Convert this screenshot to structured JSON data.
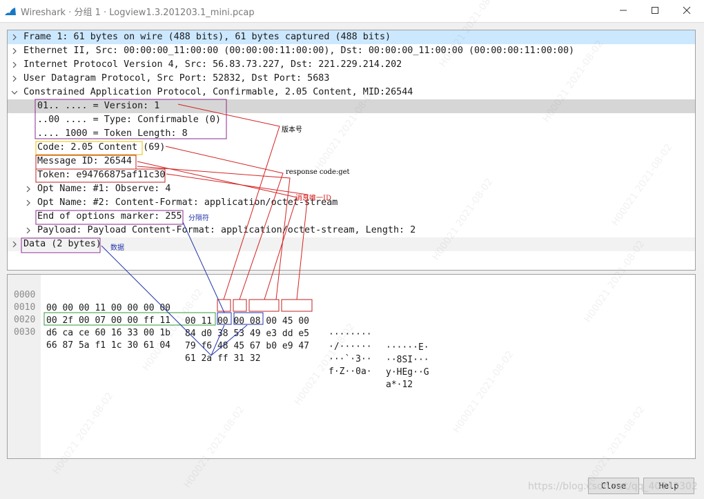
{
  "window": {
    "title": "Wireshark · 分组 1 · Logview1.3.201203.1_mini.pcap",
    "controls": [
      "minimize-icon",
      "maximize-icon",
      "close-icon"
    ]
  },
  "tree": [
    "Frame 1: 61 bytes on wire (488 bits), 61 bytes captured (488 bits)",
    "Ethernet II, Src: 00:00:00_11:00:00 (00:00:00:11:00:00), Dst: 00:00:00_11:00:00 (00:00:00:11:00:00)",
    "Internet Protocol Version 4, Src: 56.83.73.227, Dst: 221.229.214.202",
    "User Datagram Protocol, Src Port: 52832, Dst Port: 5683",
    "Constrained Application Protocol, Confirmable, 2.05 Content, MID:26544",
    "01.. .... = Version: 1",
    "..00 .... = Type: Confirmable (0)",
    ".... 1000 = Token Length: 8",
    "Code: 2.05 Content (69)",
    "Message ID: 26544",
    "Token: e94766875af11c30",
    "Opt Name: #1: Observe: 4",
    "Opt Name: #2: Content-Format: application/octet-stream",
    "End of options marker: 255",
    "Payload: Payload Content-Format: application/octet-stream, Length: 2",
    "Data (2 bytes)"
  ],
  "hex": [
    {
      "offset": "0000",
      "bytes1": "00 00 00 11 00 00 00 00",
      "bytes2": "00 11 00 00 08 00 45 00",
      "ascii1": "········",
      "ascii2": "······E·"
    },
    {
      "offset": "0010",
      "bytes1": "00 2f 00 07 00 00 ff 11",
      "bytes2": "84 d0 38 53 49 e3 dd e5",
      "ascii1": "·/······",
      "ascii2": "··8SI···"
    },
    {
      "offset": "0020",
      "bytes1": "d6 ca ce 60 16 33 00 1b",
      "bytes2": "79 f6 48 45 67 b0 e9 47",
      "ascii1": "···`·3··",
      "ascii2": "y·HEg··G"
    },
    {
      "offset": "0030",
      "bytes1": "66 87 5a f1 1c 30 61 04",
      "bytes2": "61 2a ff 31 32",
      "ascii1": "f·Z··0a·",
      "ascii2": "a*·12"
    }
  ],
  "annotations": {
    "version": "版本号",
    "response_code": "response code:get",
    "message_id": "消息唯一ID",
    "end_marker": "分隔符",
    "data": "数据"
  },
  "buttons": {
    "close": "Close",
    "help": "Help"
  },
  "watermarks": {
    "user": "H00021",
    "date": "2021-08-02",
    "blog": "https://blog.csdn.net/qq_40043302"
  },
  "colors": {
    "selected": "#cce8ff",
    "highlight": "#d6d6d6",
    "red": "#d42020",
    "purple": "#8a2a8a",
    "yellow": "#e8c000",
    "green": "#2e9a3a",
    "blue": "#2233aa"
  }
}
